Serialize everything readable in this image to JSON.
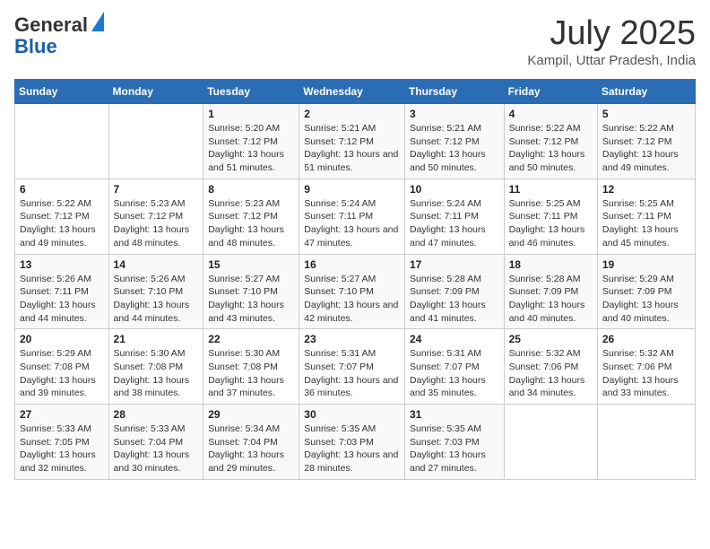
{
  "header": {
    "logo_line1": "General",
    "logo_line2": "Blue",
    "month_year": "July 2025",
    "location": "Kampil, Uttar Pradesh, India"
  },
  "calendar": {
    "days_of_week": [
      "Sunday",
      "Monday",
      "Tuesday",
      "Wednesday",
      "Thursday",
      "Friday",
      "Saturday"
    ],
    "weeks": [
      [
        {
          "day": "",
          "info": ""
        },
        {
          "day": "",
          "info": ""
        },
        {
          "day": "1",
          "info": "Sunrise: 5:20 AM\nSunset: 7:12 PM\nDaylight: 13 hours and 51 minutes."
        },
        {
          "day": "2",
          "info": "Sunrise: 5:21 AM\nSunset: 7:12 PM\nDaylight: 13 hours and 51 minutes."
        },
        {
          "day": "3",
          "info": "Sunrise: 5:21 AM\nSunset: 7:12 PM\nDaylight: 13 hours and 50 minutes."
        },
        {
          "day": "4",
          "info": "Sunrise: 5:22 AM\nSunset: 7:12 PM\nDaylight: 13 hours and 50 minutes."
        },
        {
          "day": "5",
          "info": "Sunrise: 5:22 AM\nSunset: 7:12 PM\nDaylight: 13 hours and 49 minutes."
        }
      ],
      [
        {
          "day": "6",
          "info": "Sunrise: 5:22 AM\nSunset: 7:12 PM\nDaylight: 13 hours and 49 minutes."
        },
        {
          "day": "7",
          "info": "Sunrise: 5:23 AM\nSunset: 7:12 PM\nDaylight: 13 hours and 48 minutes."
        },
        {
          "day": "8",
          "info": "Sunrise: 5:23 AM\nSunset: 7:12 PM\nDaylight: 13 hours and 48 minutes."
        },
        {
          "day": "9",
          "info": "Sunrise: 5:24 AM\nSunset: 7:11 PM\nDaylight: 13 hours and 47 minutes."
        },
        {
          "day": "10",
          "info": "Sunrise: 5:24 AM\nSunset: 7:11 PM\nDaylight: 13 hours and 47 minutes."
        },
        {
          "day": "11",
          "info": "Sunrise: 5:25 AM\nSunset: 7:11 PM\nDaylight: 13 hours and 46 minutes."
        },
        {
          "day": "12",
          "info": "Sunrise: 5:25 AM\nSunset: 7:11 PM\nDaylight: 13 hours and 45 minutes."
        }
      ],
      [
        {
          "day": "13",
          "info": "Sunrise: 5:26 AM\nSunset: 7:11 PM\nDaylight: 13 hours and 44 minutes."
        },
        {
          "day": "14",
          "info": "Sunrise: 5:26 AM\nSunset: 7:10 PM\nDaylight: 13 hours and 44 minutes."
        },
        {
          "day": "15",
          "info": "Sunrise: 5:27 AM\nSunset: 7:10 PM\nDaylight: 13 hours and 43 minutes."
        },
        {
          "day": "16",
          "info": "Sunrise: 5:27 AM\nSunset: 7:10 PM\nDaylight: 13 hours and 42 minutes."
        },
        {
          "day": "17",
          "info": "Sunrise: 5:28 AM\nSunset: 7:09 PM\nDaylight: 13 hours and 41 minutes."
        },
        {
          "day": "18",
          "info": "Sunrise: 5:28 AM\nSunset: 7:09 PM\nDaylight: 13 hours and 40 minutes."
        },
        {
          "day": "19",
          "info": "Sunrise: 5:29 AM\nSunset: 7:09 PM\nDaylight: 13 hours and 40 minutes."
        }
      ],
      [
        {
          "day": "20",
          "info": "Sunrise: 5:29 AM\nSunset: 7:08 PM\nDaylight: 13 hours and 39 minutes."
        },
        {
          "day": "21",
          "info": "Sunrise: 5:30 AM\nSunset: 7:08 PM\nDaylight: 13 hours and 38 minutes."
        },
        {
          "day": "22",
          "info": "Sunrise: 5:30 AM\nSunset: 7:08 PM\nDaylight: 13 hours and 37 minutes."
        },
        {
          "day": "23",
          "info": "Sunrise: 5:31 AM\nSunset: 7:07 PM\nDaylight: 13 hours and 36 minutes."
        },
        {
          "day": "24",
          "info": "Sunrise: 5:31 AM\nSunset: 7:07 PM\nDaylight: 13 hours and 35 minutes."
        },
        {
          "day": "25",
          "info": "Sunrise: 5:32 AM\nSunset: 7:06 PM\nDaylight: 13 hours and 34 minutes."
        },
        {
          "day": "26",
          "info": "Sunrise: 5:32 AM\nSunset: 7:06 PM\nDaylight: 13 hours and 33 minutes."
        }
      ],
      [
        {
          "day": "27",
          "info": "Sunrise: 5:33 AM\nSunset: 7:05 PM\nDaylight: 13 hours and 32 minutes."
        },
        {
          "day": "28",
          "info": "Sunrise: 5:33 AM\nSunset: 7:04 PM\nDaylight: 13 hours and 30 minutes."
        },
        {
          "day": "29",
          "info": "Sunrise: 5:34 AM\nSunset: 7:04 PM\nDaylight: 13 hours and 29 minutes."
        },
        {
          "day": "30",
          "info": "Sunrise: 5:35 AM\nSunset: 7:03 PM\nDaylight: 13 hours and 28 minutes."
        },
        {
          "day": "31",
          "info": "Sunrise: 5:35 AM\nSunset: 7:03 PM\nDaylight: 13 hours and 27 minutes."
        },
        {
          "day": "",
          "info": ""
        },
        {
          "day": "",
          "info": ""
        }
      ]
    ]
  }
}
